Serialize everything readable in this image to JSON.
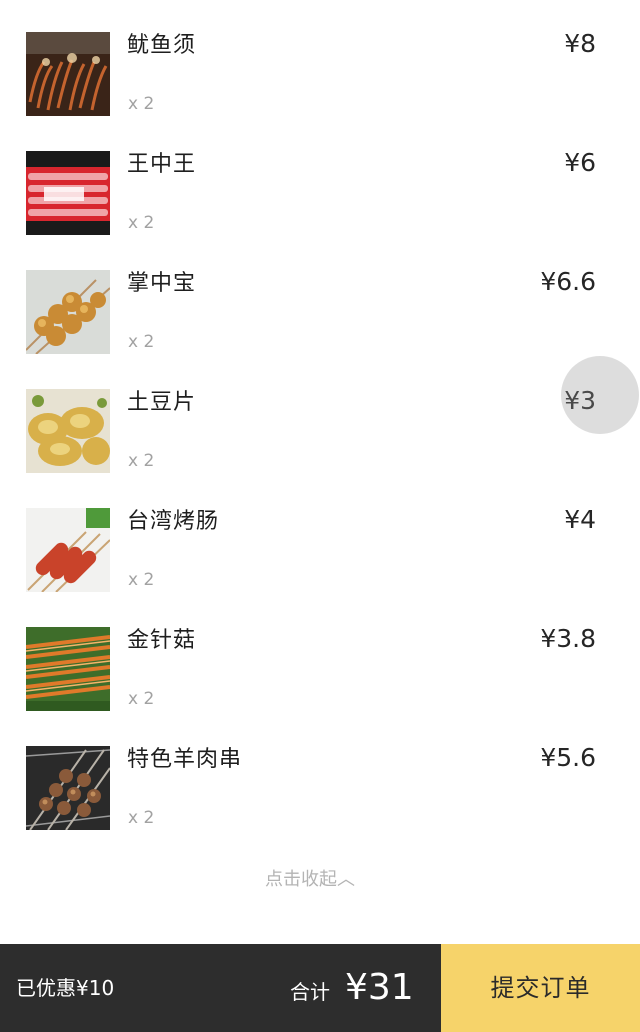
{
  "order_items": [
    {
      "name": "鱿鱼须",
      "qty": "x 2",
      "price": "¥8",
      "image": "grilled-squid-photo"
    },
    {
      "name": "王中王",
      "qty": "x 2",
      "price": "¥6",
      "image": "sausage-package-photo"
    },
    {
      "name": "掌中宝",
      "qty": "x 2",
      "price": "¥6.6",
      "image": "chicken-cartilage-skewer-photo"
    },
    {
      "name": "土豆片",
      "qty": "x 2",
      "price": "¥3",
      "image": "potato-slice-skewer-photo"
    },
    {
      "name": "台湾烤肠",
      "qty": "x 2",
      "price": "¥4",
      "image": "taiwan-sausage-skewer-photo"
    },
    {
      "name": "金针菇",
      "qty": "x 2",
      "price": "¥3.8",
      "image": "enoki-mushroom-skewer-photo"
    },
    {
      "name": "特色羊肉串",
      "qty": "x 2",
      "price": "¥5.6",
      "image": "lamb-skewer-photo"
    }
  ],
  "collapse_label": "点击收起︿",
  "footer": {
    "discount": "已优惠¥10",
    "total_label": "合计",
    "total_amount": "¥31",
    "submit_label": "提交订单"
  },
  "colors": {
    "footer_bg": "#2d2d2d",
    "submit_bg": "#f6d36a",
    "qty_text": "#a2a2a2"
  }
}
